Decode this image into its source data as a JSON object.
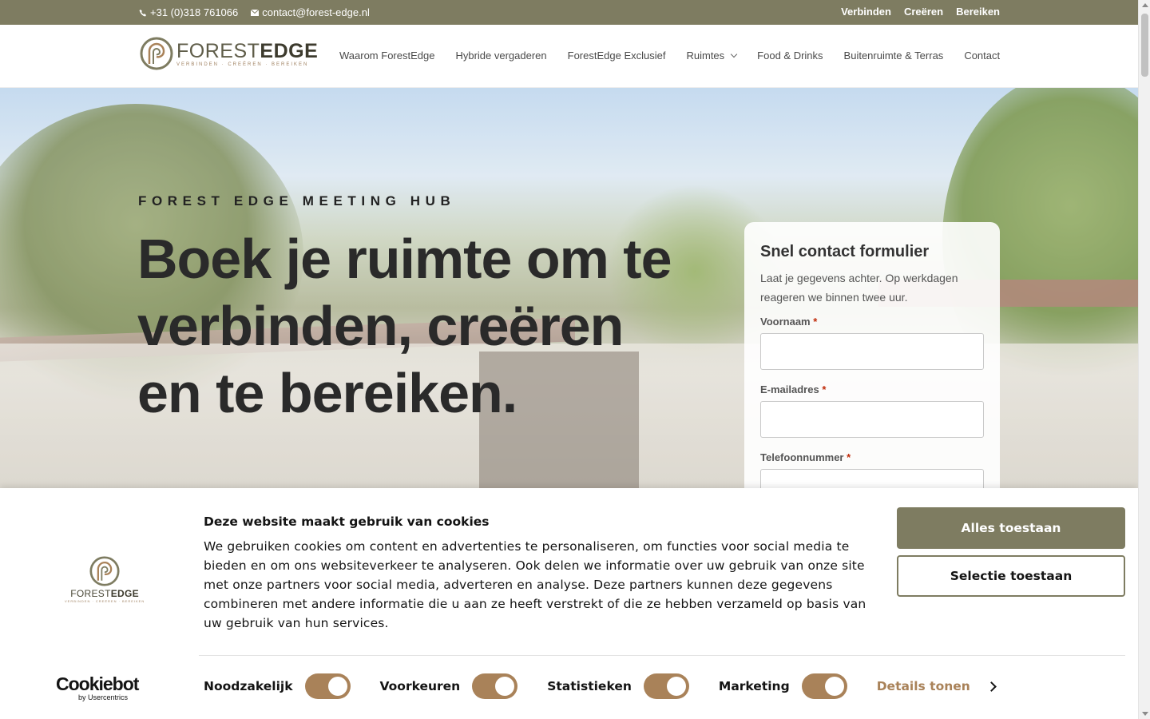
{
  "topbar": {
    "phone": "+31 (0)318 761066",
    "email": "contact@forest-edge.nl",
    "links": [
      "Verbinden",
      "Creëren",
      "Bereiken"
    ]
  },
  "logo": {
    "word_light": "FOREST",
    "word_bold": "EDGE",
    "tagline": "VERBINDEN · CREËREN · BEREIKEN"
  },
  "nav": {
    "items": [
      "Waarom ForestEdge",
      "Hybride vergaderen",
      "ForestEdge Exclusief",
      "Ruimtes",
      "Food & Drinks",
      "Buitenruimte & Terras",
      "Contact"
    ]
  },
  "hero": {
    "eyebrow": "FOREST EDGE MEETING HUB",
    "headline_1": "Boek je ruimte om te",
    "headline_2": "verbinden, creëren",
    "headline_3": "en te bereiken."
  },
  "form": {
    "title": "Snel contact formulier",
    "intro": "Laat je gegevens achter. Op werkdagen reageren we binnen twee uur.",
    "fields": [
      {
        "label": "Voornaam",
        "required": "*"
      },
      {
        "label": "E-mailadres",
        "required": "*"
      },
      {
        "label": "Telefoonnummer",
        "required": "*"
      }
    ]
  },
  "cookie": {
    "title": "Deze website maakt gebruik van cookies",
    "text": "We gebruiken cookies om content en advertenties te personaliseren, om functies voor social media te bieden en om ons websiteverkeer te analyseren. Ook delen we informatie over uw gebruik van onze site met onze partners voor social media, adverteren en analyse. Deze partners kunnen deze gegevens combineren met andere informatie die u aan ze heeft verstrekt of die ze hebben verzameld op basis van uw gebruik van hun services.",
    "btn_all": "Alles toestaan",
    "btn_selection": "Selectie toestaan",
    "toggles": [
      "Noodzakelijk",
      "Voorkeuren",
      "Statistieken",
      "Marketing"
    ],
    "details": "Details tonen",
    "cookiebot_word": "Cookiebot",
    "cookiebot_sub": "by Usercentrics",
    "logo_word_light": "FOREST",
    "logo_word_bold": "EDGE"
  },
  "colors": {
    "brand_olive": "#7e7c61",
    "toggle_brown": "#a98259"
  }
}
